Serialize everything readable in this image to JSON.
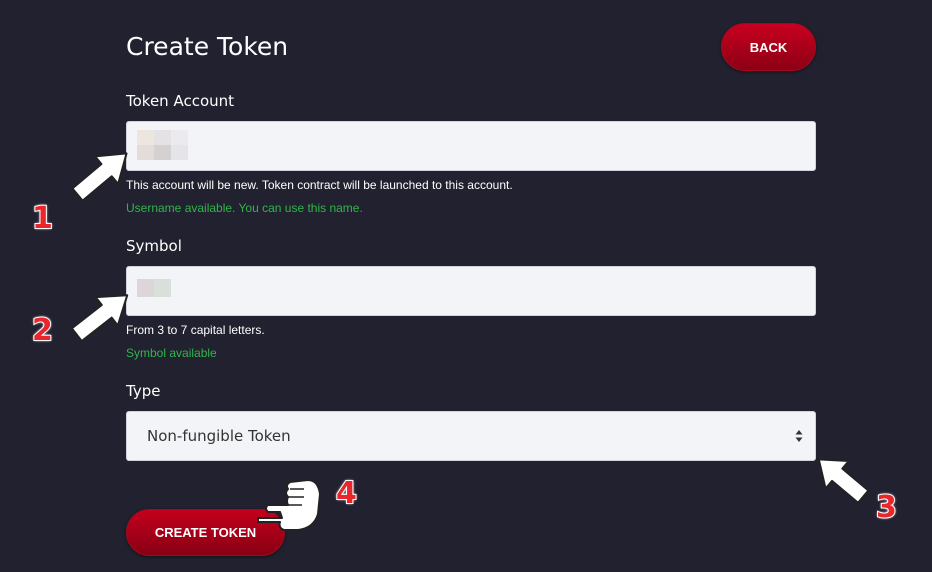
{
  "page": {
    "title": "Create Token",
    "back_label": "BACK"
  },
  "token_account": {
    "label": "Token Account",
    "hint": "This account will be new. Token contract will be launched to this account.",
    "status": "Username available. You can use this name."
  },
  "symbol": {
    "label": "Symbol",
    "hint": "From 3 to 7 capital letters.",
    "status": "Symbol available"
  },
  "type": {
    "label": "Type",
    "selected": "Non-fungible Token"
  },
  "submit_label": "CREATE TOKEN",
  "annotations": [
    "1",
    "2",
    "3",
    "4"
  ],
  "colors": {
    "background": "#22212f",
    "accent": "#c4001d",
    "success": "#2fb64a",
    "annotation": "#e8262b"
  },
  "icons": {
    "select": "sort-arrows-icon",
    "pointer_arrow": "arrow-pointer-icon",
    "pointer_hand": "hand-pointer-icon"
  }
}
